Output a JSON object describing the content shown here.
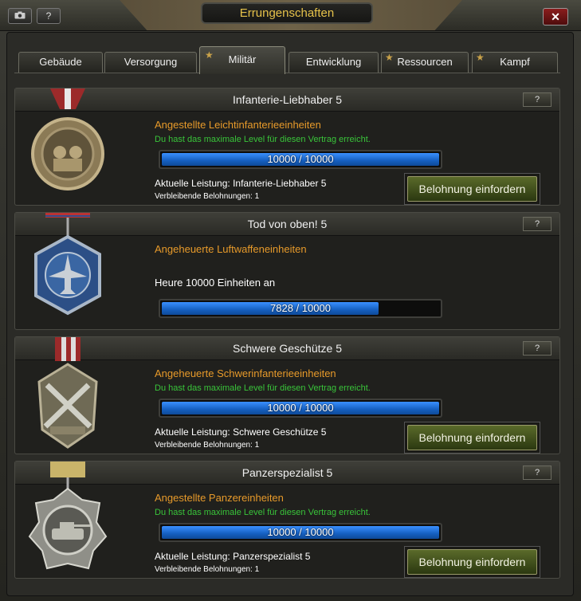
{
  "window": {
    "title": "Errungenschaften",
    "camera_icon": "camera-icon",
    "help_label": "?",
    "close_label": "✕"
  },
  "tabs": [
    {
      "label": "Gebäude",
      "active": false
    },
    {
      "label": "Versorgung",
      "active": false
    },
    {
      "label": "Militär",
      "active": true
    },
    {
      "label": "Entwicklung",
      "active": false
    },
    {
      "label": "Ressourcen",
      "active": false
    },
    {
      "label": "Kampf",
      "active": false
    }
  ],
  "achievements": [
    {
      "title": "Infanterie-Liebhaber 5",
      "help": "?",
      "category": "Angestellte Leichtinfanterieeinheiten",
      "max_msg": "Du hast das maximale Level für diesen Vertrag erreicht.",
      "progress_text": "10000 / 10000",
      "progress_current": 10000,
      "progress_total": 10000,
      "current": "Aktuelle Leistung: Infanterie-Liebhaber 5",
      "remaining": "Verbleibende Belohnungen: 1",
      "claim_label": "Belohnung einfordern",
      "medal_icon": "infantry-medal-icon"
    },
    {
      "title": "Tod von oben! 5",
      "help": "?",
      "category": "Angeheuerte Luftwaffeneinheiten",
      "task": "Heure 10000 Einheiten an",
      "progress_text": "7828 / 10000",
      "progress_current": 7828,
      "progress_total": 10000,
      "medal_icon": "airforce-medal-icon"
    },
    {
      "title": "Schwere Geschütze 5",
      "help": "?",
      "category": "Angeheuerte Schwerinfanterieeinheiten",
      "max_msg": "Du hast das maximale Level für diesen Vertrag erreicht.",
      "progress_text": "10000 / 10000",
      "progress_current": 10000,
      "progress_total": 10000,
      "current": "Aktuelle Leistung: Schwere Geschütze 5",
      "remaining": "Verbleibende Belohnungen: 1",
      "claim_label": "Belohnung einfordern",
      "medal_icon": "heavy-guns-medal-icon"
    },
    {
      "title": "Panzerspezialist 5",
      "help": "?",
      "category": "Angestellte Panzereinheiten",
      "max_msg": "Du hast das maximale Level für diesen Vertrag erreicht.",
      "progress_text": "10000 / 10000",
      "progress_current": 10000,
      "progress_total": 10000,
      "current": "Aktuelle Leistung: Panzerspezialist 5",
      "remaining": "Verbleibende Belohnungen: 1",
      "claim_label": "Belohnung einfordern",
      "medal_icon": "tank-medal-icon"
    }
  ],
  "colors": {
    "title": "#e6c24a",
    "category": "#e79a2a",
    "max_msg": "#39c43a",
    "progress": "#1f74e0"
  }
}
